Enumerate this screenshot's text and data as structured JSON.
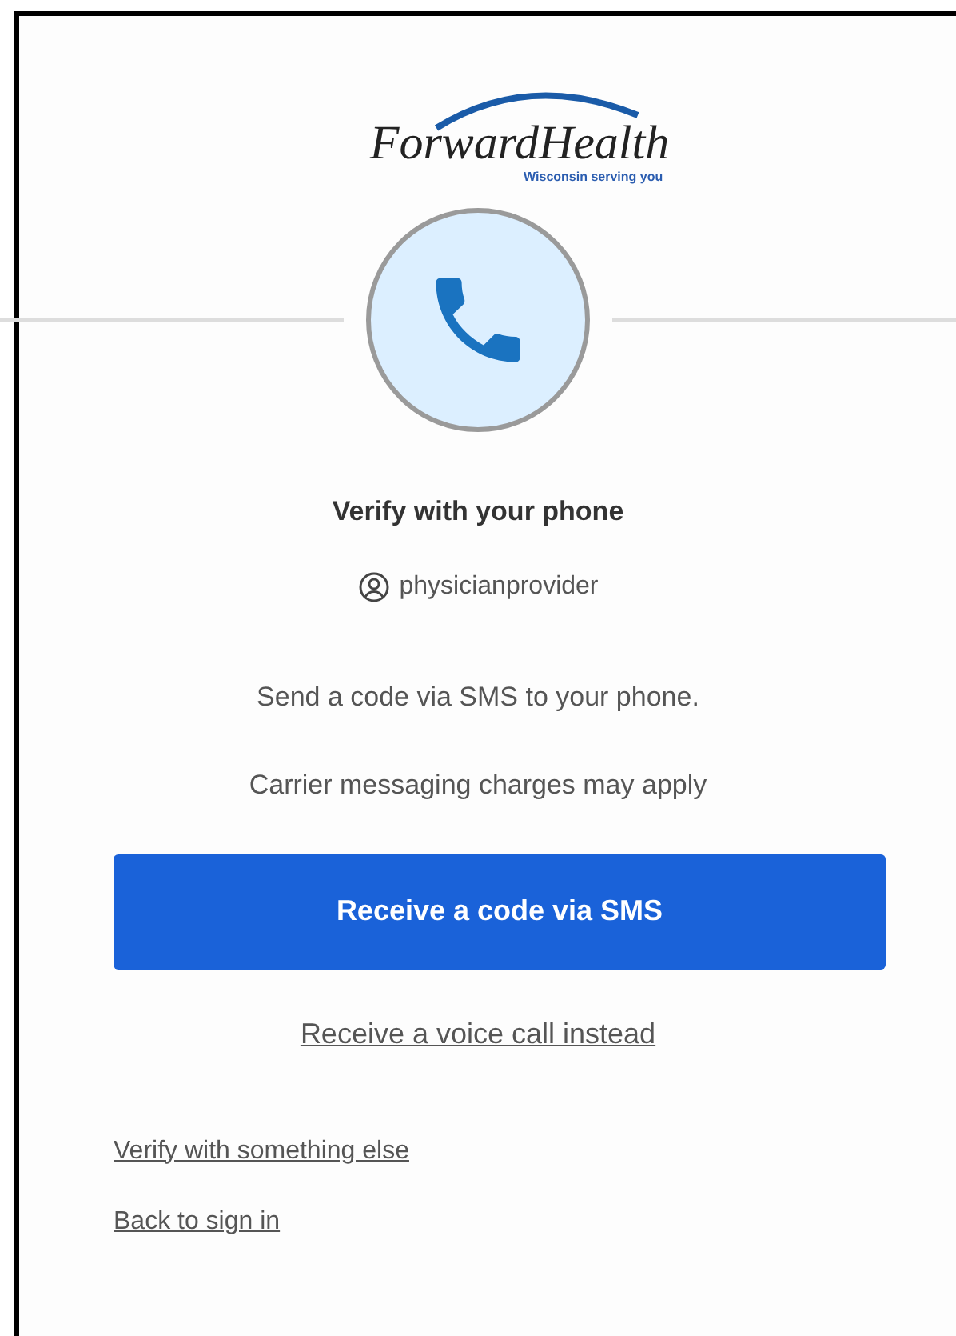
{
  "logo": {
    "name": "ForwardHealth",
    "tagline": "Wisconsin serving you"
  },
  "title": "Verify with your phone",
  "username": "physicianprovider",
  "messages": [
    "Send a code via SMS to your phone.",
    "Carrier messaging charges may apply"
  ],
  "primary_button": "Receive a code via SMS",
  "alt_link": "Receive a voice call instead",
  "footer_links": [
    "Verify with something else",
    "Back to sign in"
  ]
}
